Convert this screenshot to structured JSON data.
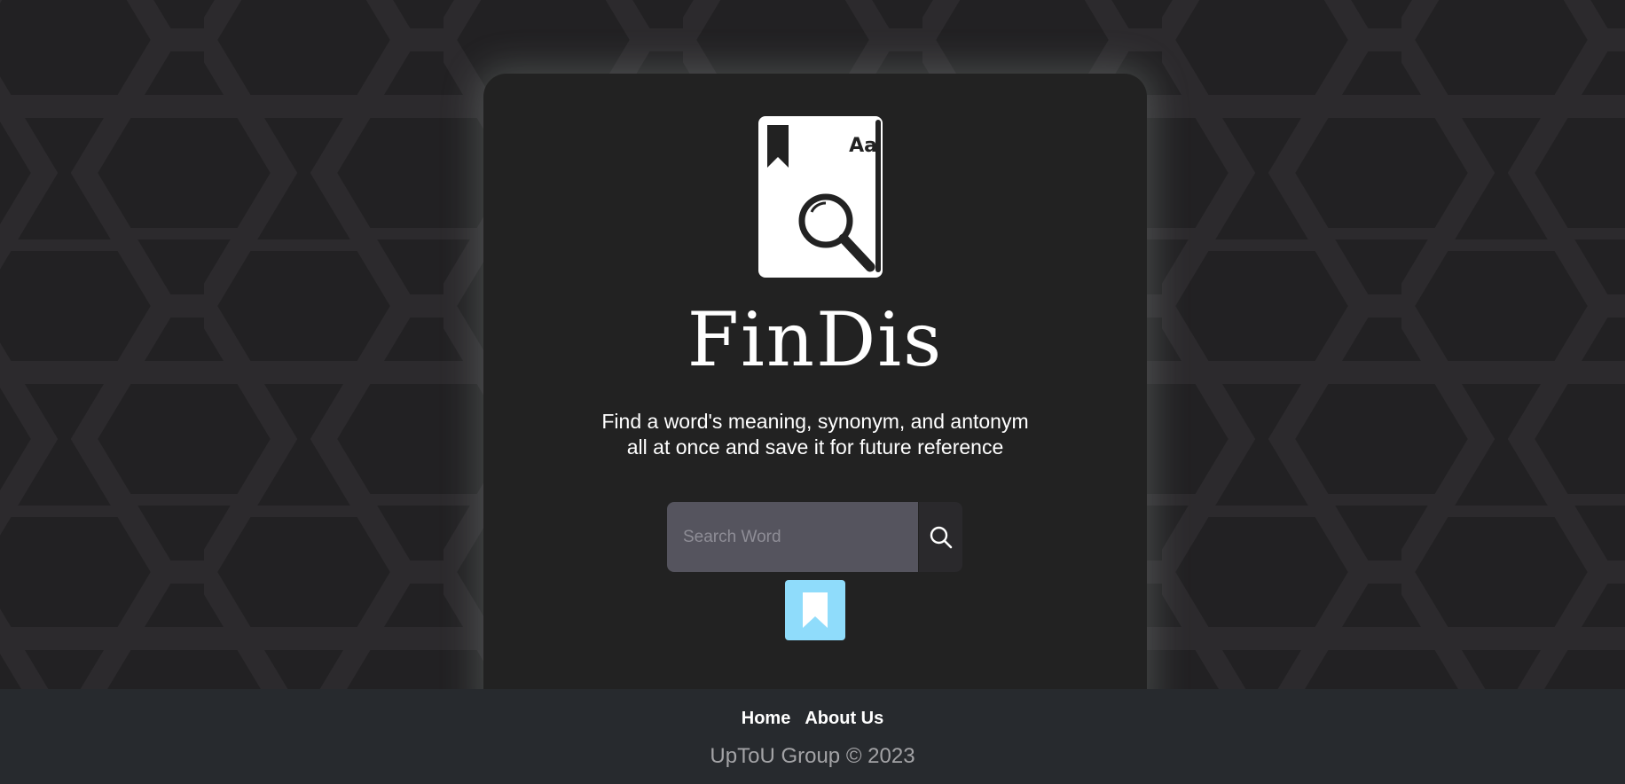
{
  "app": {
    "brand_name": "FinDis",
    "logo_book_label": "Aa"
  },
  "hero": {
    "tagline_line1": "Find a word's meaning, synonym, and antonym",
    "tagline_line2": "all at once and save it for future reference"
  },
  "search": {
    "placeholder": "Search Word",
    "value": ""
  },
  "icons": {
    "logo": "dictionary-book-magnifier-icon",
    "search_button": "search-icon",
    "bookmark_button": "bookmark-icon"
  },
  "footer": {
    "nav": [
      {
        "label": "Home"
      },
      {
        "label": "About Us"
      }
    ],
    "copyright": "UpToU Group © 2023"
  },
  "colors": {
    "page_background": "#1f1e20",
    "card_background": "#222222",
    "search_input_bg": "#55545e",
    "bookmark_accent": "#8fdcfb",
    "footer_background": "#272a2e"
  }
}
